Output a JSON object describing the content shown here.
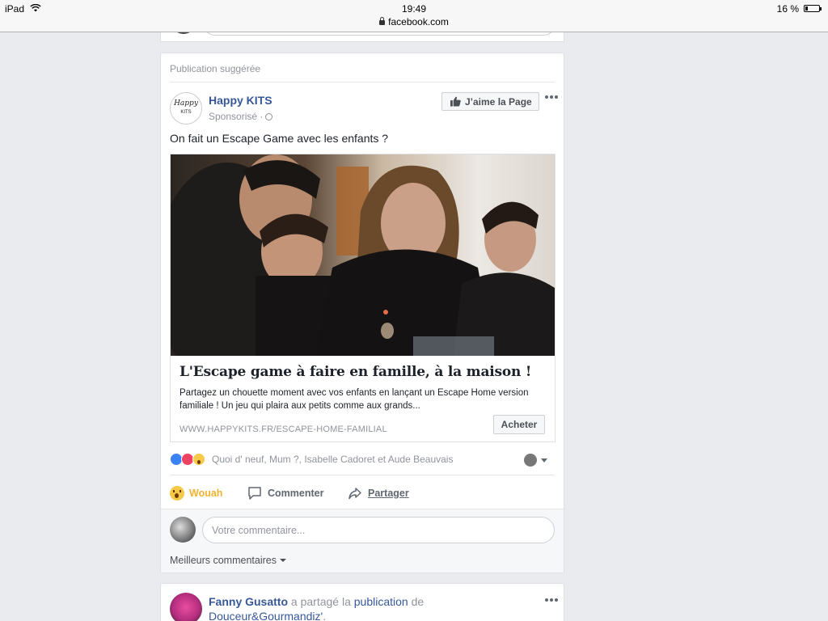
{
  "status_bar": {
    "device": "iPad",
    "time": "19:49",
    "battery": "16 %",
    "battery_level": 0.16
  },
  "browser": {
    "url": "facebook.com"
  },
  "post": {
    "label": "Publication suggérée",
    "page_name": "Happy KITS",
    "avatar_text": "Happy",
    "avatar_subtext": "KITS",
    "sponsored": "Sponsorisé ·",
    "like_page_label": "J’aime la Page",
    "text": "On fait un Escape Game avec les enfants ?",
    "link": {
      "title": "L'Escape game à faire en famille, à la maison !",
      "description": "Partagez un chouette moment avec vos enfants en lançant un Escape Home version familiale ! Un jeu qui plaira aux petits comme aux grands...",
      "domain": "WWW.HAPPYKITS.FR/ESCAPE-HOME-FAMILIAL",
      "cta": "Acheter"
    },
    "reactions_text": "Quoi d' neuf, Mum ?, Isabelle Cadoret et Aude Beauvais",
    "actions": {
      "wow": "Wouah",
      "comment": "Commenter",
      "share": "Partager"
    },
    "comment_placeholder": "Votre commentaire...",
    "best_comments": "Meilleurs commentaires"
  },
  "next_post": {
    "author": "Fanny Gusatto",
    "shared": " a partagé la ",
    "publication": "publication",
    "de": " de",
    "source": "Douceur&Gourmandiz'",
    "period": "."
  },
  "colors": {
    "link_blue": "#365899",
    "muted": "#90949c",
    "wow_yellow": "#f0b330",
    "background": "#e9ebee"
  }
}
